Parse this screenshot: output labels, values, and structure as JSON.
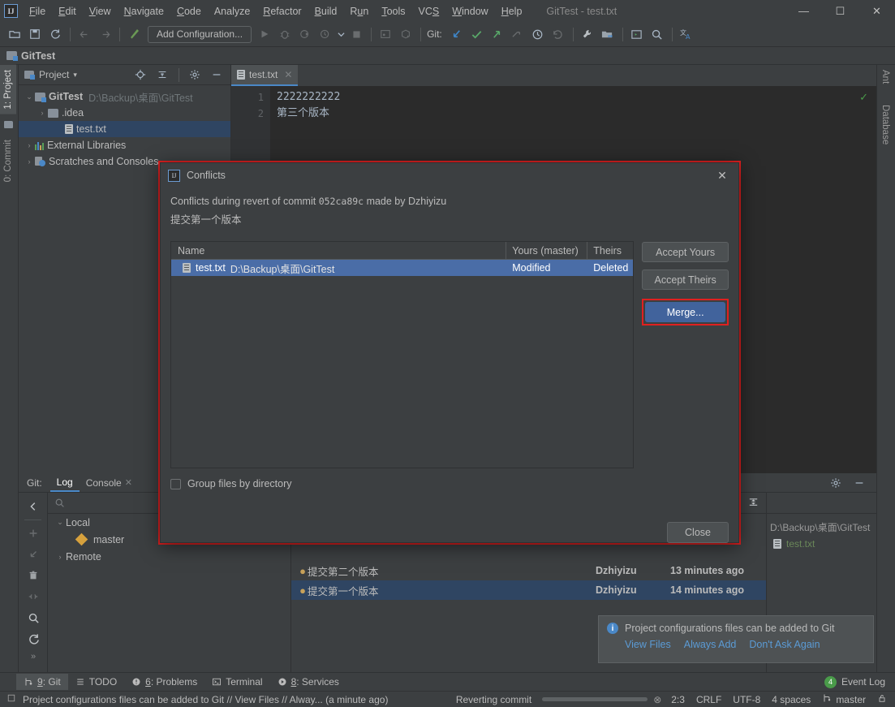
{
  "window": {
    "title": "GitTest - test.txt",
    "logo": "ij-logo",
    "minimize": "—",
    "maximize": "☐",
    "close": "✕"
  },
  "menu": {
    "items": [
      "File",
      "Edit",
      "View",
      "Navigate",
      "Code",
      "Analyze",
      "Refactor",
      "Build",
      "Run",
      "Tools",
      "VCS",
      "Window",
      "Help"
    ]
  },
  "toolbar": {
    "add_configuration": "Add Configuration...",
    "git_label": "Git:",
    "icons": [
      "open-folder-icon",
      "save-icon",
      "sync-icon",
      "back-arrow-icon",
      "forward-arrow-icon",
      "build-hammer-icon",
      "run-icon",
      "debug-icon",
      "run-coverage-icon",
      "profile-icon",
      "stop-icon",
      "updates-icon",
      "package-icon",
      "update-project-icon",
      "commit-icon",
      "push-icon",
      "fetch-icon",
      "history-icon",
      "revert-icon",
      "settings-wrench-icon",
      "project-structure-icon",
      "terminal-icon",
      "search-everywhere-icon",
      "translate-icon"
    ]
  },
  "navbar": {
    "project_name": "GitTest"
  },
  "left_strip": {
    "tabs": [
      "1: Project",
      "0: Commit"
    ],
    "active": "1: Project"
  },
  "right_strip": {
    "tabs": [
      "Ant",
      "Database"
    ]
  },
  "project_tool": {
    "title": "Project",
    "dropdown": "▾",
    "header_icons": [
      "locate-icon",
      "collapse-all-icon",
      "settings-gear-icon",
      "hide-icon"
    ],
    "tree": [
      {
        "arrow": "⌄",
        "label": "GitTest",
        "path": "D:\\Backup\\桌面\\GitTest",
        "bold": true,
        "icon": "project-folder-icon",
        "indent": 0,
        "selected": false
      },
      {
        "arrow": "›",
        "label": ".idea",
        "path": "",
        "bold": false,
        "icon": "folder-icon",
        "indent": 1,
        "selected": false
      },
      {
        "arrow": "",
        "label": "test.txt",
        "path": "",
        "bold": false,
        "icon": "file-icon",
        "indent": 2,
        "selected": true
      },
      {
        "arrow": "›",
        "label": "External Libraries",
        "path": "",
        "bold": false,
        "icon": "library-icon",
        "indent": 0,
        "selected": false
      },
      {
        "arrow": "›",
        "label": "Scratches and Consoles",
        "path": "",
        "bold": false,
        "icon": "scratches-icon",
        "indent": 0,
        "selected": false
      }
    ]
  },
  "editor": {
    "tab_label": "test.txt",
    "tab_close": "✕",
    "line_numbers": [
      "1",
      "2"
    ],
    "lines": [
      "2222222222",
      "第三个版本"
    ],
    "inspection_ok": "✓"
  },
  "git_tool": {
    "label": "Git:",
    "tabs": [
      "Log",
      "Console"
    ],
    "active_tab": "Log",
    "console_close": "✕",
    "settings_icon": "gear-icon",
    "hide_icon": "hide-icon",
    "search_placeholder": "",
    "branches": [
      {
        "arrow": "⌄",
        "label": "Local",
        "indent": 0,
        "icon": ""
      },
      {
        "arrow": "",
        "label": "master",
        "indent": 1,
        "icon": "tag-icon"
      },
      {
        "arrow": "›",
        "label": "Remote",
        "indent": 0,
        "icon": ""
      }
    ],
    "toolbar_icons": [
      "filter-icon",
      "group-icon",
      "expand-icon",
      "collapse-icon"
    ],
    "commits": [
      {
        "message": "提交第二个版本",
        "author": "Dzhiyizu",
        "date": "13 minutes ago",
        "selected": false
      },
      {
        "message": "提交第一个版本",
        "author": "Dzhiyizu",
        "date": "14 minutes ago",
        "selected": true
      }
    ],
    "details_path": "D:\\Backup\\桌面\\GitTest",
    "details_file": "test.txt"
  },
  "dialog": {
    "title": "Conflicts",
    "close": "✕",
    "message_prefix": "Conflicts during revert of commit ",
    "commit_sha": "052ca89c",
    "message_suffix": " made by Dzhiyizu",
    "commit_message": "提交第一个版本",
    "columns": {
      "name": "Name",
      "yours": "Yours (master)",
      "theirs": "Theirs"
    },
    "rows": [
      {
        "file": "test.txt",
        "path": "D:\\Backup\\桌面\\GitTest",
        "yours": "Modified",
        "theirs": "Deleted",
        "selected": true
      }
    ],
    "buttons": {
      "accept_yours": "Accept Yours",
      "accept_theirs": "Accept Theirs",
      "merge": "Merge...",
      "close": "Close"
    },
    "group_checkbox": "Group files by directory",
    "group_checked": false,
    "highlight_color": "#e02020",
    "primary_color": "#41639c"
  },
  "balloon": {
    "icon": "info-icon",
    "text": "Project configurations files can be added to Git",
    "links": [
      "View Files",
      "Always Add",
      "Don't Ask Again"
    ]
  },
  "bottom_tabs": [
    {
      "label": "9: Git",
      "icon": "git-branch-icon",
      "active": true
    },
    {
      "label": "TODO",
      "icon": "todo-icon",
      "active": false
    },
    {
      "label": "6: Problems",
      "icon": "problems-icon",
      "active": false
    },
    {
      "label": "Terminal",
      "icon": "terminal-icon",
      "active": false
    },
    {
      "label": "8: Services",
      "icon": "services-icon",
      "active": false
    }
  ],
  "event_log": {
    "label": "Event Log",
    "count": "4"
  },
  "status_bar": {
    "message": "Project configurations files can be added to Git // View Files // Alway... (a minute ago)",
    "task": "Reverting commit",
    "progress": 100,
    "cancel": "⊗",
    "caret": "2:3",
    "line_sep": "CRLF",
    "encoding": "UTF-8",
    "indent": "4 spaces",
    "branch": "master",
    "lock_icon": "lock-icon"
  }
}
